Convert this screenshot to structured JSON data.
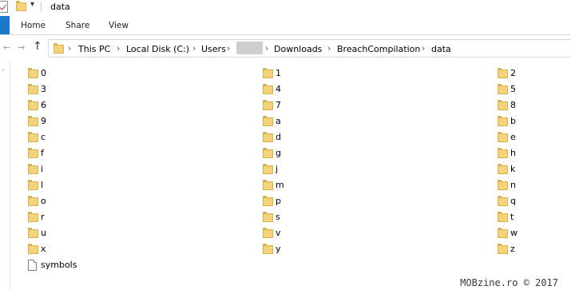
{
  "window": {
    "title": "data"
  },
  "ribbon": {
    "tabs": [
      "Home",
      "Share",
      "View"
    ]
  },
  "address_bar": {
    "path": [
      "This PC",
      "Local Disk (C:)",
      "Users",
      "",
      "Downloads",
      "BreachCompilation",
      "data"
    ]
  },
  "items": {
    "col1": [
      {
        "name": "0",
        "type": "folder"
      },
      {
        "name": "3",
        "type": "folder"
      },
      {
        "name": "6",
        "type": "folder"
      },
      {
        "name": "9",
        "type": "folder"
      },
      {
        "name": "c",
        "type": "folder"
      },
      {
        "name": "f",
        "type": "folder"
      },
      {
        "name": "i",
        "type": "folder"
      },
      {
        "name": "l",
        "type": "folder"
      },
      {
        "name": "o",
        "type": "folder"
      },
      {
        "name": "r",
        "type": "folder"
      },
      {
        "name": "u",
        "type": "folder"
      },
      {
        "name": "x",
        "type": "folder"
      },
      {
        "name": "symbols",
        "type": "file"
      }
    ],
    "col2": [
      {
        "name": "1",
        "type": "folder"
      },
      {
        "name": "4",
        "type": "folder"
      },
      {
        "name": "7",
        "type": "folder"
      },
      {
        "name": "a",
        "type": "folder"
      },
      {
        "name": "d",
        "type": "folder"
      },
      {
        "name": "g",
        "type": "folder"
      },
      {
        "name": "j",
        "type": "folder"
      },
      {
        "name": "m",
        "type": "folder"
      },
      {
        "name": "p",
        "type": "folder"
      },
      {
        "name": "s",
        "type": "folder"
      },
      {
        "name": "v",
        "type": "folder"
      },
      {
        "name": "y",
        "type": "folder"
      }
    ],
    "col3": [
      {
        "name": "2",
        "type": "folder"
      },
      {
        "name": "5",
        "type": "folder"
      },
      {
        "name": "8",
        "type": "folder"
      },
      {
        "name": "b",
        "type": "folder"
      },
      {
        "name": "e",
        "type": "folder"
      },
      {
        "name": "h",
        "type": "folder"
      },
      {
        "name": "k",
        "type": "folder"
      },
      {
        "name": "n",
        "type": "folder"
      },
      {
        "name": "q",
        "type": "folder"
      },
      {
        "name": "t",
        "type": "folder"
      },
      {
        "name": "w",
        "type": "folder"
      },
      {
        "name": "z",
        "type": "folder"
      }
    ]
  },
  "watermark": "MOBzine.ro © 2017",
  "colors": {
    "accent": "#1979ca",
    "folder": "#f5d37a"
  }
}
